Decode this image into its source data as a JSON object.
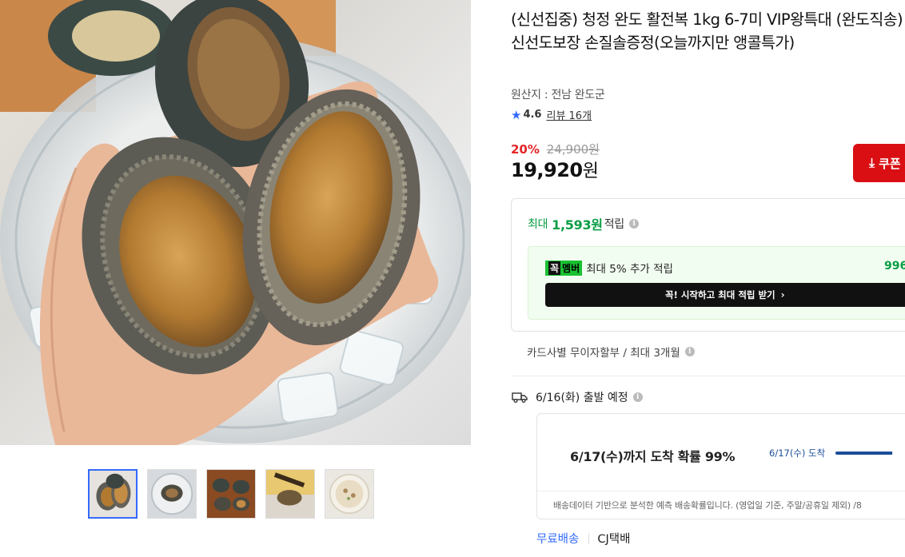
{
  "product": {
    "title": "(신선집중) 청정 완도 활전복 1kg 6-7미 VIP왕특대 (완도직송) 신선도보장 손질솔증정(오늘까지만 앵콜특가)",
    "origin": "원산지 : 전남 완도군",
    "rating": {
      "icon": "star-icon",
      "score": "4.6",
      "review_text": "리뷰 16개"
    }
  },
  "price": {
    "discount": "20%",
    "original": "24,900원",
    "final_number": "19,920",
    "final_unit": "원",
    "coupon_label": "쿠폰"
  },
  "reward": {
    "prefix": "최대",
    "amount": "1,593원",
    "suffix": "적립",
    "member_badge_1": "꼭",
    "member_badge_2": "멤버",
    "member_desc": "최대 5% 추가 적립",
    "member_pct": "996",
    "member_cta": "꼭! 시작하고 최대 적립 받기"
  },
  "installment": "카드사별 무이자할부 / 최대 3개월",
  "shipping": {
    "ship_date": "6/16(화) 출발 예정",
    "arrival_probability": "6/17(수)까지 도착 확률 99%",
    "arrival_label": "6/17(수) 도착",
    "arrival_rate": 0.99,
    "note": "배송데이터 기반으로 분석한 예측 배송확률입니다. (영업일 기준, 주말/공휴일 제외) /8",
    "free_shipping": "무료배송",
    "carrier": "CJ택배"
  },
  "gallery": {
    "thumbnail_count": 5,
    "active_index": 0
  },
  "colors": {
    "accent_blue": "#346aff",
    "discount_red": "#e52528",
    "coupon_red": "#d90f13",
    "reward_green": "#0a9e44"
  }
}
